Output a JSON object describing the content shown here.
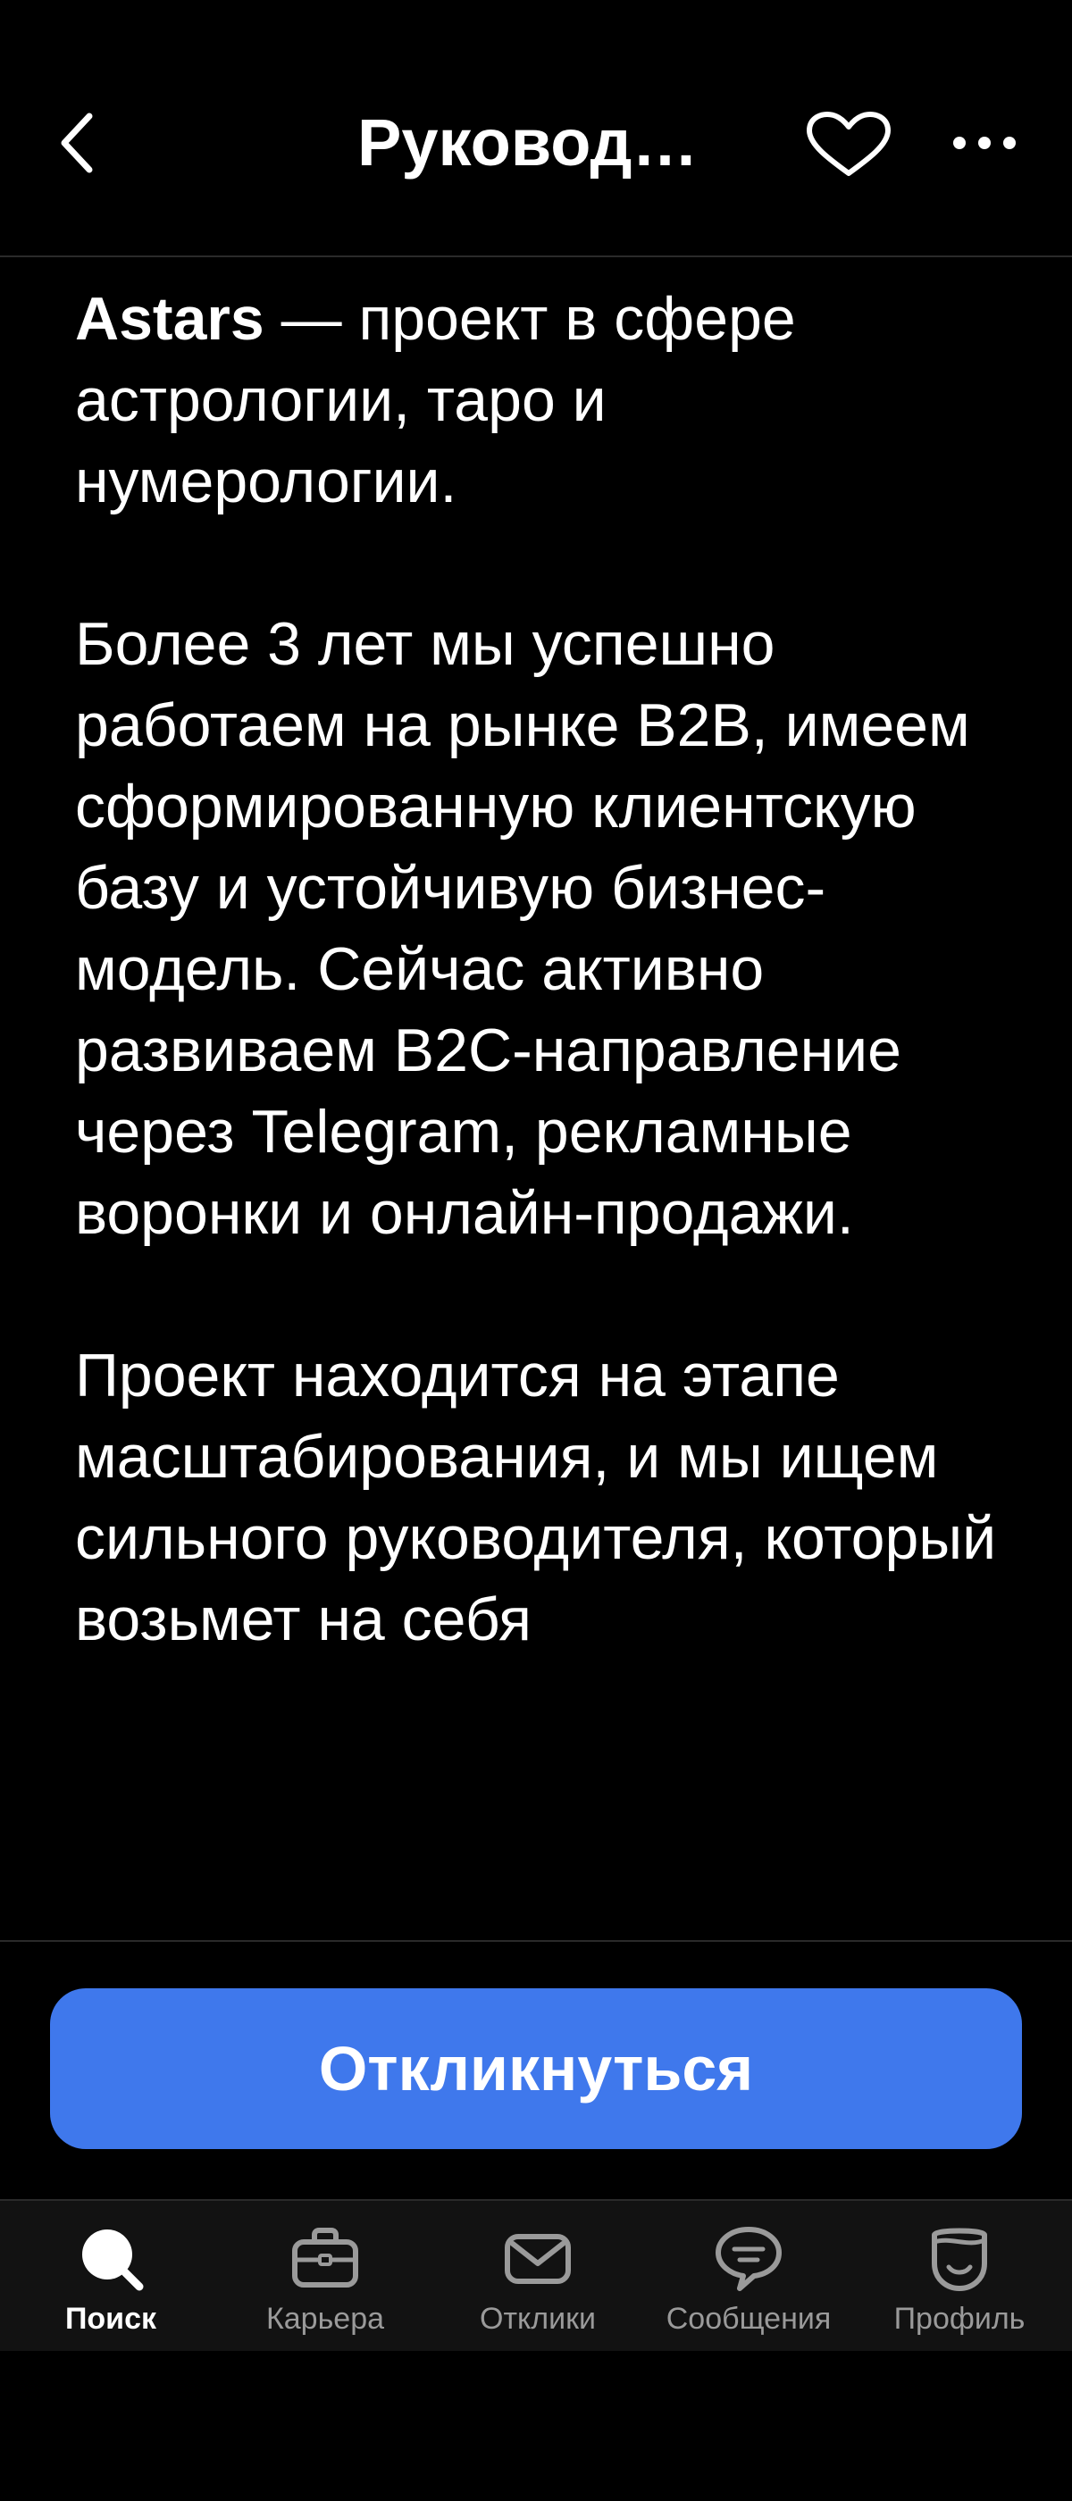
{
  "header": {
    "title": "Руковод…",
    "back_icon": "chevron-left-icon",
    "favorite_icon": "heart-icon",
    "more_icon": "more-horizontal-icon"
  },
  "description": {
    "paragraph1_bold": "Astars",
    "paragraph1_rest": " — проект в сфере астрологии, таро и нумерологии.",
    "paragraph2": "Более 3 лет мы успешно работаем на рынке B2B, имеем сформированную клиентскую базу и устойчивую бизнес-модель. Сейчас активно развиваем B2C-направление через Telegram, рекламные воронки и онлайн-продажи.",
    "paragraph3": "Проект находится на этапе масштабирования, и мы ищем сильного руководителя, который возьмет на себя"
  },
  "cta": {
    "label": "Откликнуться",
    "color": "#3f78ec"
  },
  "bottom_nav": {
    "items": [
      {
        "label": "Поиск",
        "icon": "search-icon",
        "active": true
      },
      {
        "label": "Карьера",
        "icon": "briefcase-icon",
        "active": false
      },
      {
        "label": "Отклики",
        "icon": "envelope-icon",
        "active": false
      },
      {
        "label": "Сообщения",
        "icon": "chat-bubble-icon",
        "active": false
      },
      {
        "label": "Профиль",
        "icon": "profile-icon",
        "active": false
      }
    ]
  }
}
